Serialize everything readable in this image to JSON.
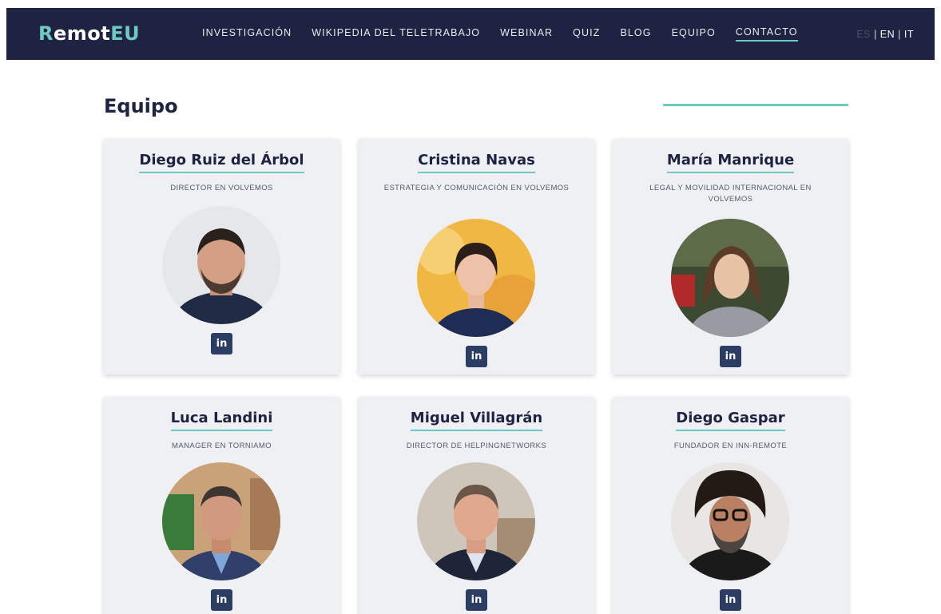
{
  "brand": {
    "part1": "R",
    "part2": "emot",
    "part3": "EU"
  },
  "nav": {
    "items": [
      {
        "label": "INVESTIGACIÓN"
      },
      {
        "label": "WIKIPEDIA DEL TELETRABAJO"
      },
      {
        "label": "WEBINAR"
      },
      {
        "label": "QUIZ"
      },
      {
        "label": "BLOG"
      },
      {
        "label": "EQUIPO"
      },
      {
        "label": "CONTACTO"
      }
    ],
    "active_item": "CONTACTO"
  },
  "language": {
    "es": "ES",
    "separator": "|",
    "en": "EN",
    "it": "IT",
    "current": "ES"
  },
  "section": {
    "title": "Equipo"
  },
  "team": [
    {
      "name": "Diego Ruiz del Árbol",
      "role": "DIRECTOR EN VOLVEMOS",
      "linkedin_icon": "in"
    },
    {
      "name": "Cristina Navas",
      "role": "ESTRATEGIA Y COMUNICACIÓN EN VOLVEMOS",
      "linkedin_icon": "in"
    },
    {
      "name": "María Manrique",
      "role": "LEGAL Y MOVILIDAD INTERNACIONAL EN VOLVEMOS",
      "linkedin_icon": "in"
    },
    {
      "name": "Luca Landini",
      "role": "MANAGER EN TORNIAMO",
      "linkedin_icon": "in"
    },
    {
      "name": "Miguel Villagrán",
      "role": "DIRECTOR DE HELPINGNETWORKS",
      "linkedin_icon": "in"
    },
    {
      "name": "Diego Gaspar",
      "role": "FUNDADOR EN INN-REMOTE",
      "linkedin_icon": "in"
    }
  ],
  "colors": {
    "nav_bg": "#1d2340",
    "accent": "#6fc9c2",
    "card_bg": "#eef0f4",
    "linkedin_bg": "#2c3d63"
  }
}
